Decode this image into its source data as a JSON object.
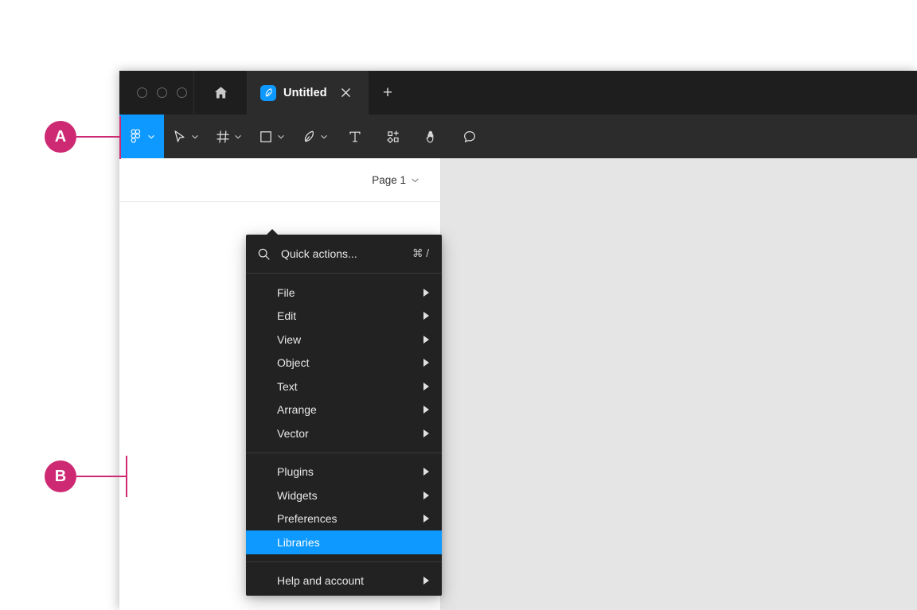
{
  "window": {
    "traffic_lights": [
      "close",
      "minimize",
      "zoom"
    ],
    "home_icon": "home-icon"
  },
  "tabs": {
    "items": [
      {
        "favicon": "figma-file-icon",
        "title": "Untitled",
        "close": "×",
        "active": true
      }
    ],
    "new_tab": "+"
  },
  "toolbar": {
    "menu_button": {
      "icon": "figma-logo-icon",
      "chevron": "chevron-down-icon"
    },
    "tools": [
      {
        "name": "move-tool",
        "icon": "cursor-arrow-icon",
        "has_chevron": true
      },
      {
        "name": "frame-tool",
        "icon": "frame-hash-icon",
        "has_chevron": true
      },
      {
        "name": "shape-tool",
        "icon": "rectangle-icon",
        "has_chevron": true
      },
      {
        "name": "pen-tool",
        "icon": "pen-nib-icon",
        "has_chevron": true
      },
      {
        "name": "text-tool",
        "icon": "text-t-icon",
        "has_chevron": false
      },
      {
        "name": "actions-tool",
        "icon": "components-plus-icon",
        "has_chevron": false
      },
      {
        "name": "hand-tool",
        "icon": "hand-icon",
        "has_chevron": false
      },
      {
        "name": "comment-tool",
        "icon": "comment-bubble-icon",
        "has_chevron": false
      }
    ]
  },
  "left_panel": {
    "page_selector": {
      "label": "Page 1",
      "chevron": "chevron-down-icon"
    }
  },
  "menu": {
    "search": {
      "icon": "search-icon",
      "label": "Quick actions...",
      "shortcut": "⌘ /"
    },
    "groups": [
      {
        "items": [
          {
            "label": "File",
            "submenu": true,
            "selected": false
          },
          {
            "label": "Edit",
            "submenu": true,
            "selected": false
          },
          {
            "label": "View",
            "submenu": true,
            "selected": false
          },
          {
            "label": "Object",
            "submenu": true,
            "selected": false
          },
          {
            "label": "Text",
            "submenu": true,
            "selected": false
          },
          {
            "label": "Arrange",
            "submenu": true,
            "selected": false
          },
          {
            "label": "Vector",
            "submenu": true,
            "selected": false
          }
        ]
      },
      {
        "items": [
          {
            "label": "Plugins",
            "submenu": true,
            "selected": false
          },
          {
            "label": "Widgets",
            "submenu": true,
            "selected": false
          },
          {
            "label": "Preferences",
            "submenu": true,
            "selected": false
          },
          {
            "label": "Libraries",
            "submenu": false,
            "selected": true
          }
        ]
      },
      {
        "items": [
          {
            "label": "Help and account",
            "submenu": true,
            "selected": false
          }
        ]
      }
    ]
  },
  "annotations": [
    {
      "label": "A",
      "target": "menu-button"
    },
    {
      "label": "B",
      "target": "libraries-menu-item"
    }
  ],
  "colors": {
    "accent_blue": "#0D99FF",
    "marker_pink": "#CD2A73",
    "menu_bg": "#222222",
    "toolbar_bg": "#2C2C2C",
    "tabstrip_bg": "#1E1E1E",
    "canvas_bg": "#E5E5E5"
  }
}
